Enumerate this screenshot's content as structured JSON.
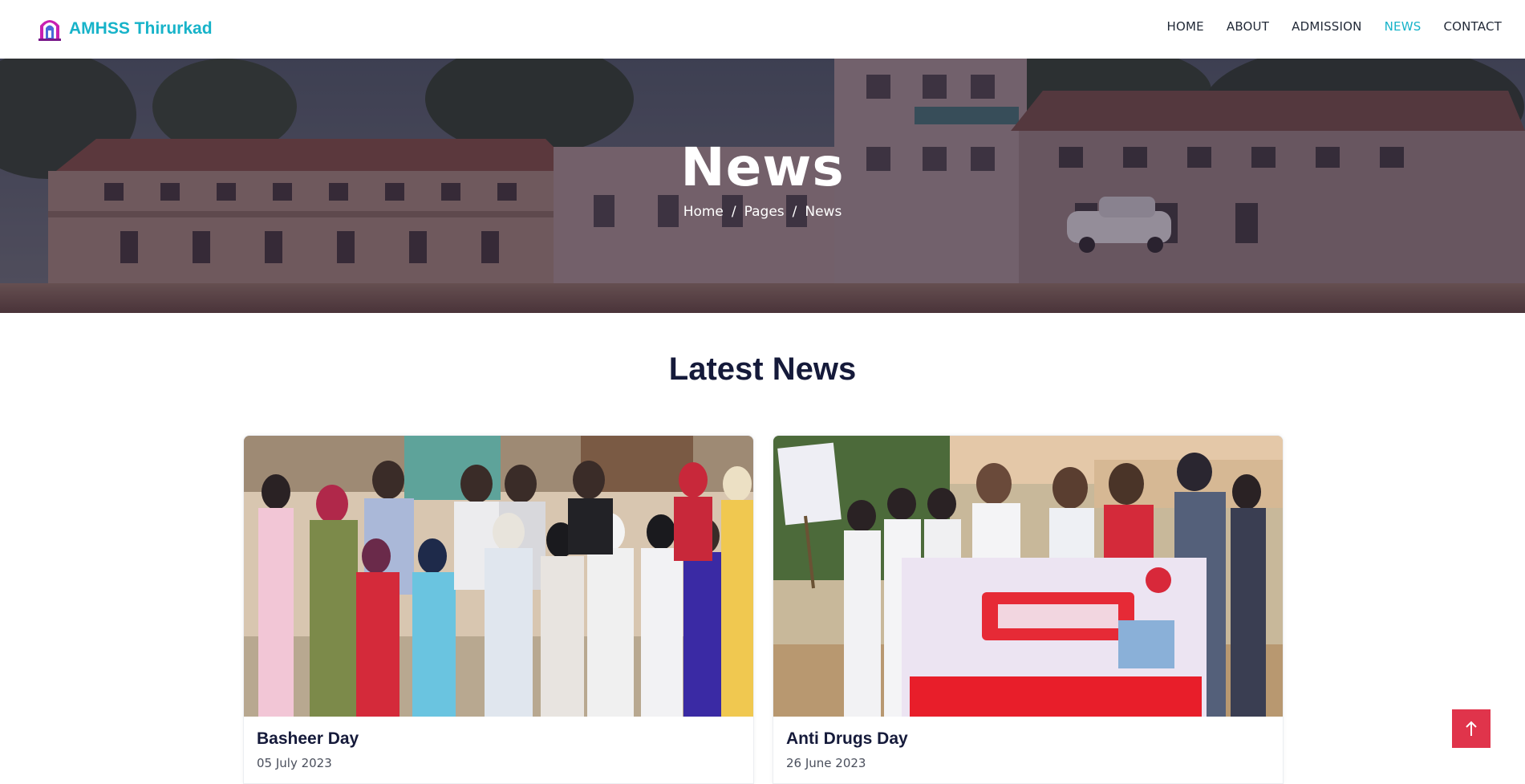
{
  "brand": {
    "name": "AMHSS Thirurkad",
    "logo_icon": "school-arch-logo"
  },
  "nav": {
    "items": [
      {
        "label": "HOME",
        "active": false
      },
      {
        "label": "ABOUT",
        "active": false
      },
      {
        "label": "ADMISSION",
        "active": false
      },
      {
        "label": "NEWS",
        "active": true
      },
      {
        "label": "CONTACT",
        "active": false
      }
    ]
  },
  "hero": {
    "title": "News",
    "breadcrumb": [
      "Home",
      "Pages",
      "News"
    ],
    "separator": "/"
  },
  "section": {
    "title": "Latest News"
  },
  "news": [
    {
      "title": "Basheer Day",
      "date": "05 July 2023",
      "image": "students-group-photo"
    },
    {
      "title": "Anti Drugs Day",
      "date": "26 June 2023",
      "image": "scout-students-vimukthi-banner"
    }
  ],
  "colors": {
    "accent": "#17b3c9",
    "heading": "#151a3a",
    "back_to_top": "#e0344b"
  },
  "back_to_top": {
    "icon": "arrow-up-icon"
  }
}
